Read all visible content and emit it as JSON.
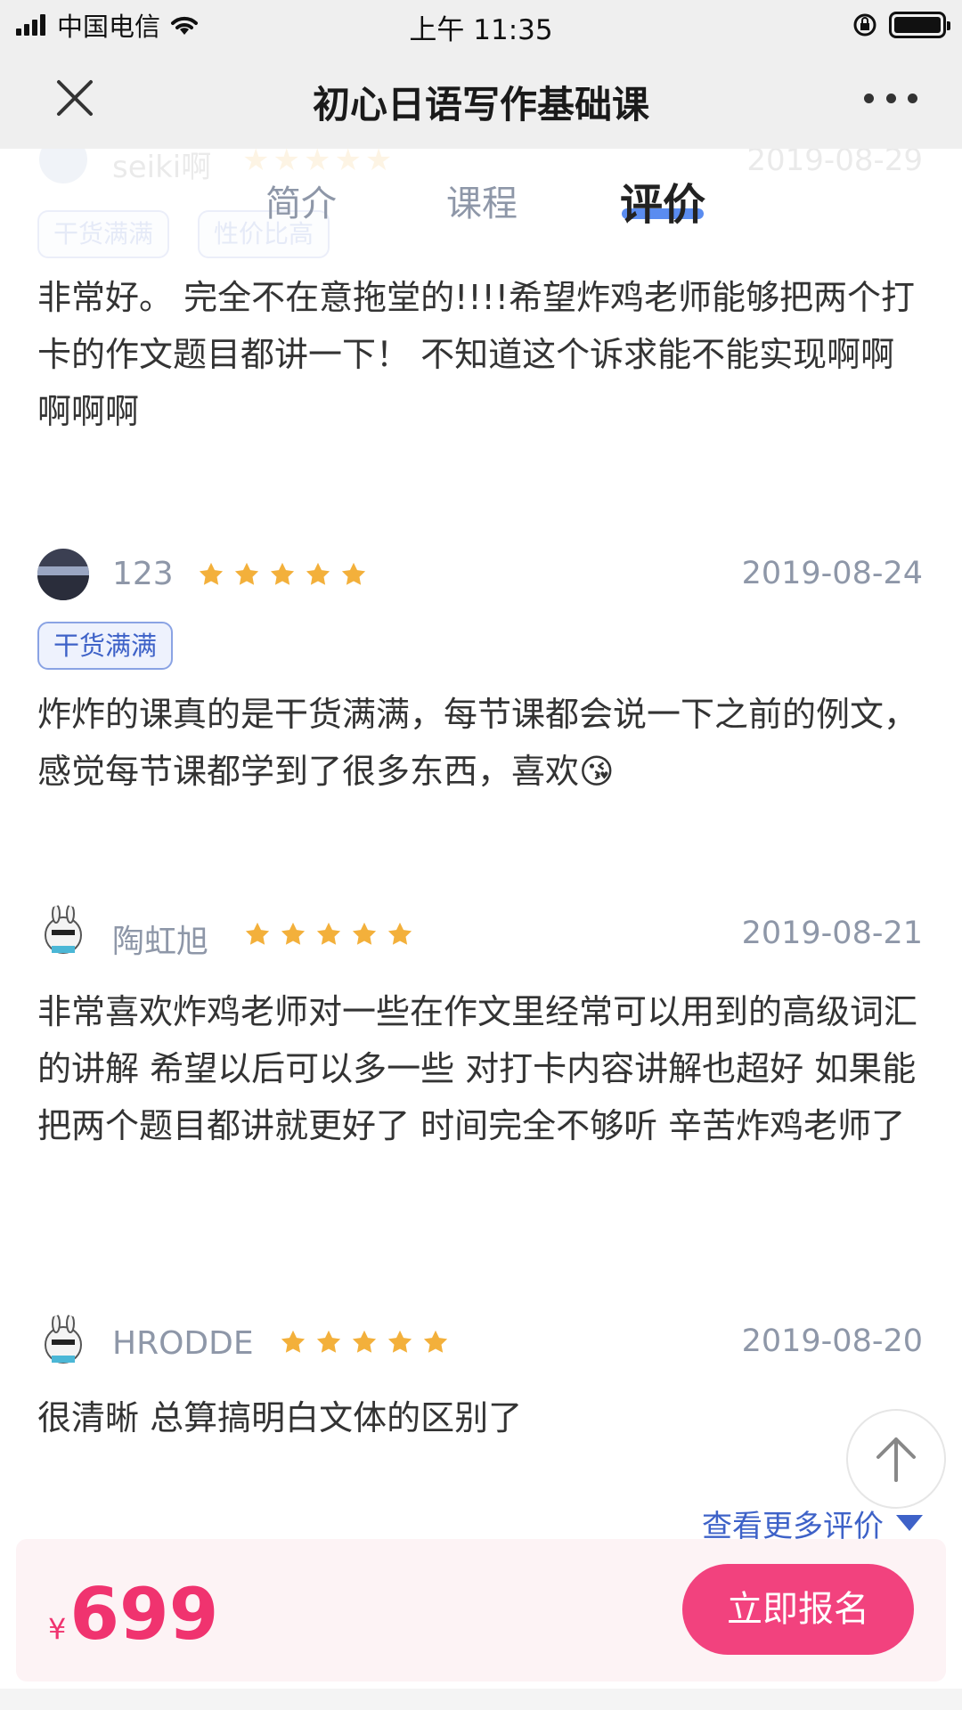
{
  "status_bar": {
    "carrier": "中国电信",
    "time": "上午 11:35"
  },
  "nav": {
    "title": "初心日语写作基础课"
  },
  "tabs": [
    {
      "label": "简介",
      "active": false
    },
    {
      "label": "课程",
      "active": false
    },
    {
      "label": "评价",
      "active": true
    }
  ],
  "faded_review": {
    "user": "seiki啊",
    "rating": 5,
    "date": "2019-08-29",
    "tags": [
      "干货满满",
      "性价比高"
    ]
  },
  "reviews": [
    {
      "user": "",
      "rating": null,
      "date": "",
      "tags": [],
      "text": "非常好。 完全不在意拖堂的!!!!希望炸鸡老师能够把两个打卡的作文题目都讲一下！ 不知道这个诉求能不能实现啊啊啊啊啊"
    },
    {
      "user": "123",
      "rating": 5,
      "date": "2019-08-24",
      "tags": [
        "干货满满"
      ],
      "text": "炸炸的课真的是干货满满，每节课都会说一下之前的例文，感觉每节课都学到了很多东西，喜欢😘"
    },
    {
      "user": "陶虹旭",
      "rating": 5,
      "date": "2019-08-21",
      "tags": [],
      "text": "非常喜欢炸鸡老师对一些在作文里经常可以用到的高级词汇的讲解 希望以后可以多一些 对打卡内容讲解也超好 如果能把两个题目都讲就更好了 时间完全不够听 辛苦炸鸡老师了"
    },
    {
      "user": "HRODDE",
      "rating": 5,
      "date": "2019-08-20",
      "tags": [],
      "text": "很清晰 总算搞明白文体的区别了"
    }
  ],
  "more_reviews_label": "查看更多评价",
  "bottom_bar": {
    "currency": "¥",
    "price": "699",
    "enroll_label": "立即报名"
  },
  "colors": {
    "accent_pink": "#f2427e",
    "star": "#f3b03b",
    "tag_blue": "#3e62c8",
    "tab_underline": "#5a8cf0"
  }
}
